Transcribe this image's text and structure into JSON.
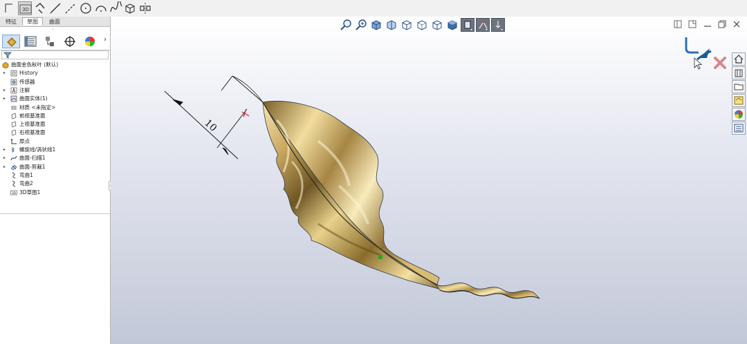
{
  "toolbar": {
    "tools": [
      {
        "icon": "sketch-icon"
      },
      {
        "icon": "3d-sketch-icon",
        "label": "3D"
      },
      {
        "icon": "smart-dimension-icon"
      },
      {
        "icon": "line-icon"
      },
      {
        "icon": "centerline-icon"
      },
      {
        "icon": "circle-icon"
      },
      {
        "icon": "arc-icon"
      },
      {
        "icon": "spline-icon"
      },
      {
        "icon": "box-icon"
      },
      {
        "icon": "mirror-icon"
      }
    ]
  },
  "panel": {
    "tabs": [
      "特征",
      "草图",
      "曲面"
    ],
    "active_tab": 1,
    "tree": [
      {
        "label": "曲面金色秋叶 (默认)",
        "icon": "part-icon",
        "indent": 0,
        "expand": ""
      },
      {
        "label": "History",
        "icon": "history-icon",
        "indent": 1,
        "expand": "▸"
      },
      {
        "label": "传感器",
        "icon": "sensor-icon",
        "indent": 1,
        "expand": ""
      },
      {
        "label": "注解",
        "icon": "annotation-icon",
        "indent": 1,
        "expand": "▸"
      },
      {
        "label": "曲面实体(1)",
        "icon": "surface-body-icon",
        "indent": 1,
        "expand": "▸"
      },
      {
        "label": "材质 <未指定>",
        "icon": "material-icon",
        "indent": 1,
        "expand": ""
      },
      {
        "label": "前视基准面",
        "icon": "plane-icon",
        "indent": 1,
        "expand": ""
      },
      {
        "label": "上视基准面",
        "icon": "plane-icon",
        "indent": 1,
        "expand": ""
      },
      {
        "label": "右视基准面",
        "icon": "plane-icon",
        "indent": 1,
        "expand": ""
      },
      {
        "label": "原点",
        "icon": "origin-icon",
        "indent": 1,
        "expand": ""
      },
      {
        "label": "螺旋线/涡状线1",
        "icon": "helix-icon",
        "indent": 1,
        "expand": "▸"
      },
      {
        "label": "曲面-扫描1",
        "icon": "surface-sweep-icon",
        "indent": 1,
        "expand": "▸"
      },
      {
        "label": "曲面-剪裁1",
        "icon": "surface-trim-icon",
        "indent": 1,
        "expand": "▸"
      },
      {
        "label": "弯曲1",
        "icon": "flex-icon",
        "indent": 1,
        "expand": ""
      },
      {
        "label": "弯曲2",
        "icon": "flex-icon",
        "indent": 1,
        "expand": ""
      },
      {
        "label": "3D草图1",
        "icon": "3d-sketch-icon",
        "indent": 1,
        "expand": ""
      }
    ]
  },
  "viewport": {
    "dimension_value": "10",
    "colors": {
      "leaf_gold": "#c9a760",
      "leaf_highlight": "#f6e7b4",
      "leaf_shadow": "#6e5624",
      "background_bottom": "#c2c8d8"
    }
  }
}
